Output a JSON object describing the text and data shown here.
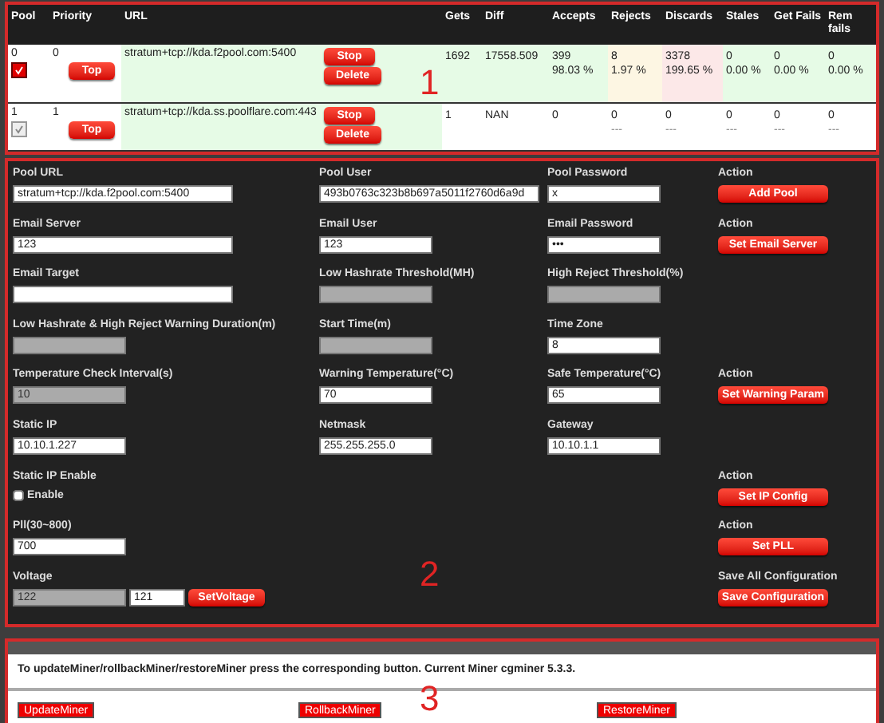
{
  "pools": {
    "annotation": "1",
    "columns": [
      "Pool",
      "Priority",
      "URL",
      "Gets",
      "Diff",
      "Accepts",
      "Rejects",
      "Discards",
      "Stales",
      "Get Fails",
      "Rem fails"
    ],
    "rows": [
      {
        "selected": true,
        "pool": "0",
        "priority": "0",
        "top_button": "Top",
        "url": "stratum+tcp://kda.f2pool.com:5400",
        "stop_button": "Stop",
        "delete_button": "Delete",
        "gets": "1692",
        "diff": "17558.509",
        "accepts": [
          "399",
          "98.03 %"
        ],
        "rejects": [
          "8",
          "1.97 %"
        ],
        "discards": [
          "3378",
          "199.65 %"
        ],
        "stales": [
          "0",
          "0.00 %"
        ],
        "get_fails": [
          "0",
          "0.00 %"
        ],
        "rem_fails": [
          "0",
          "0.00 %"
        ]
      },
      {
        "selected": false,
        "pool": "1",
        "priority": "1",
        "top_button": "Top",
        "url": "stratum+tcp://kda.ss.poolflare.com:443",
        "stop_button": "Stop",
        "delete_button": "Delete",
        "gets": "1",
        "diff": "NAN",
        "accepts": [
          "0"
        ],
        "rejects": [
          "0",
          "---"
        ],
        "discards": [
          "0",
          "---"
        ],
        "stales": [
          "0",
          "---"
        ],
        "get_fails": [
          "0",
          "---"
        ],
        "rem_fails": [
          "0",
          "---"
        ]
      }
    ]
  },
  "settings": {
    "annotation": "2",
    "rows": [
      {
        "first": {
          "kind": "long_field",
          "label": "Pool URL",
          "value": "stratum+tcp://kda.f2pool.com:5400",
          "disabled": false
        },
        "second": {
          "kind": "long_field",
          "label": "Pool User",
          "value": "493b0763c323b8b697a5011f2760d6a9d",
          "disabled": false
        },
        "third": {
          "kind": "field",
          "label": "Pool Password",
          "value": "x",
          "disabled": false
        },
        "action": {
          "kind": "button",
          "label": "Action",
          "button": "Add Pool"
        }
      },
      {
        "first": {
          "kind": "long_field",
          "label": "Email Server",
          "value": "123",
          "disabled": false
        },
        "second": {
          "kind": "field",
          "label": "Email User",
          "value": "123",
          "disabled": false
        },
        "third": {
          "kind": "field",
          "label": "Email Password",
          "value": "•••",
          "disabled": false
        },
        "action": {
          "kind": "button",
          "label": "Action",
          "button": "Set Email Server"
        }
      },
      {
        "first": {
          "kind": "long_field",
          "label": "Email Target",
          "disabled": false
        },
        "second": {
          "kind": "field",
          "label": "Low Hashrate Threshold(MH)",
          "disabled": true
        },
        "third": {
          "kind": "field",
          "label": "High Reject Threshold(%)",
          "disabled": true
        }
      },
      {
        "first": {
          "kind": "field",
          "label": "Low Hashrate & High Reject Warning Duration(m)",
          "disabled": true
        },
        "second": {
          "kind": "field",
          "label": "Start Time(m)",
          "disabled": true
        },
        "third": {
          "kind": "field",
          "label": "Time Zone",
          "value": "8",
          "disabled": false
        }
      },
      {
        "first": {
          "kind": "field",
          "label": "Temperature Check Interval(s)",
          "value": "10",
          "disabled": true
        },
        "second": {
          "kind": "field",
          "label": "Warning Temperature(°C)",
          "value": "70",
          "disabled": false
        },
        "third": {
          "kind": "field",
          "label": "Safe Temperature(°C)",
          "value": "65",
          "disabled": false
        },
        "action": {
          "kind": "button",
          "label": "Action",
          "button": "Set Warning Param"
        }
      },
      {
        "first": {
          "kind": "field",
          "label": "Static IP",
          "value": "10.10.1.227",
          "disabled": false
        },
        "second": {
          "kind": "field",
          "label": "Netmask",
          "value": "255.255.255.0",
          "disabled": false
        },
        "third": {
          "kind": "field",
          "label": "Gateway",
          "value": "10.10.1.1",
          "disabled": false
        }
      },
      {
        "first": {
          "kind": "checkbox",
          "label": "Static IP Enable",
          "option": "Enable",
          "checked": false
        },
        "action": {
          "kind": "button",
          "label": "Action",
          "button": "Set IP Config"
        }
      },
      {
        "first": {
          "kind": "field",
          "label": "Pll(30~800)",
          "value": "700",
          "disabled": false
        },
        "action": {
          "kind": "button",
          "label": "Action",
          "button": "Set PLL"
        }
      },
      {
        "first": {
          "kind": "voltage",
          "label": "Voltage",
          "fields": [
            {
              "value": "122",
              "disabled": true
            },
            {
              "value": "121",
              "disabled": false
            }
          ],
          "button": "SetVoltage"
        },
        "action": {
          "kind": "button",
          "label": "Save All Configuration",
          "button": "Save Configuration"
        }
      }
    ]
  },
  "miner": {
    "annotation": "3",
    "message": "To updateMiner/rollbackMiner/restoreMiner press the corresponding button. Current Miner cgminer 5.3.3.",
    "buttons": [
      "UpdateMiner",
      "RollbackMiner",
      "RestoreMiner"
    ]
  }
}
